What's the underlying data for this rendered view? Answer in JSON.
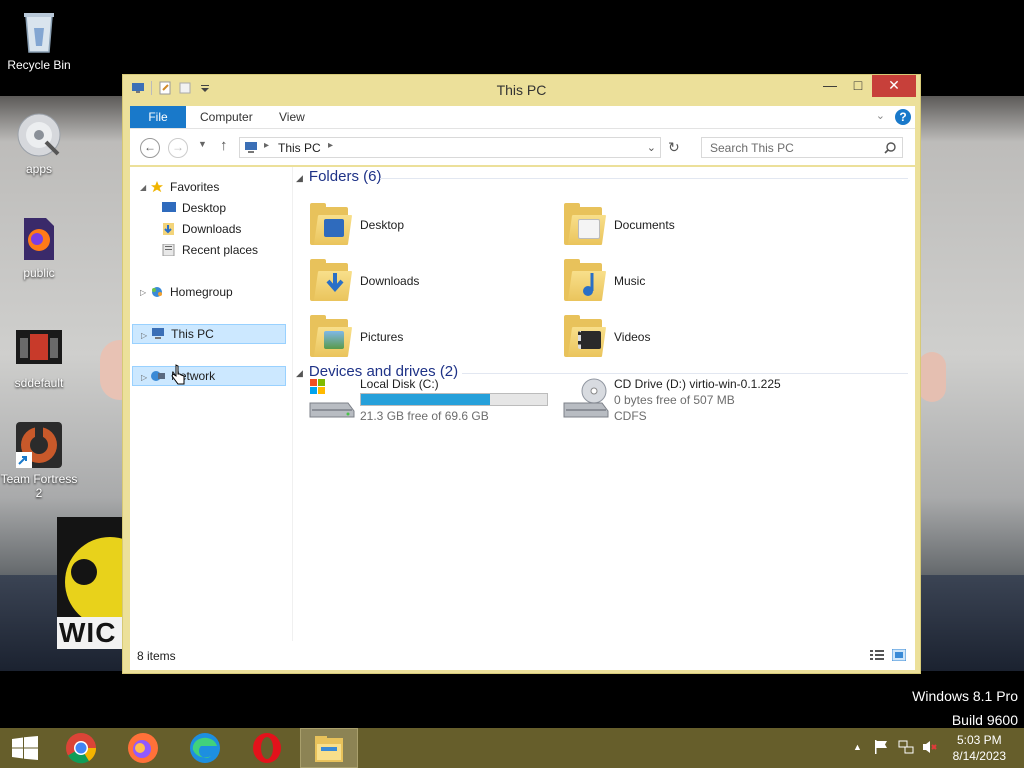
{
  "desktop": {
    "icons": [
      {
        "label": "Recycle Bin",
        "icon": "recycle-bin-icon"
      },
      {
        "label": "apps",
        "icon": "disc-icon"
      },
      {
        "label": "public",
        "icon": "firefox-file-icon"
      },
      {
        "label": "sddefault",
        "icon": "image-icon"
      },
      {
        "label": "Team Fortress 2",
        "icon": "team-fortress-icon"
      }
    ],
    "wallpaper_text": "WIC",
    "os_line1": "Windows 8.1 Pro",
    "os_line2": "Build 9600"
  },
  "window": {
    "title": "This PC",
    "ribbon_tabs": [
      "File",
      "Computer",
      "View"
    ],
    "help_label": "?",
    "address": "This PC",
    "search_placeholder": "Search This PC",
    "nav": {
      "favorites": "Favorites",
      "favorites_items": [
        "Desktop",
        "Downloads",
        "Recent places"
      ],
      "homegroup": "Homegroup",
      "this_pc": "This PC",
      "network": "Network"
    },
    "folders_header": "Folders (6)",
    "folders": [
      "Desktop",
      "Documents",
      "Downloads",
      "Music",
      "Pictures",
      "Videos"
    ],
    "devices_header": "Devices and drives (2)",
    "drives": [
      {
        "name": "Local Disk (C:)",
        "free": "21.3 GB free of 69.6 GB",
        "used_fraction": 0.694
      },
      {
        "name": "CD Drive (D:) virtio-win-0.1.225",
        "free": "0 bytes free of 507 MB",
        "fs": "CDFS"
      }
    ],
    "status": "8 items"
  },
  "taskbar": {
    "apps": [
      "Start",
      "Chrome",
      "Firefox",
      "Edge",
      "Opera",
      "File Explorer"
    ],
    "time": "5:03 PM",
    "date": "8/14/2023"
  },
  "colors": {
    "accent": "#1979ca",
    "window_frame": "#ece09a",
    "taskbar": "#665e2b",
    "close": "#c7403a"
  }
}
